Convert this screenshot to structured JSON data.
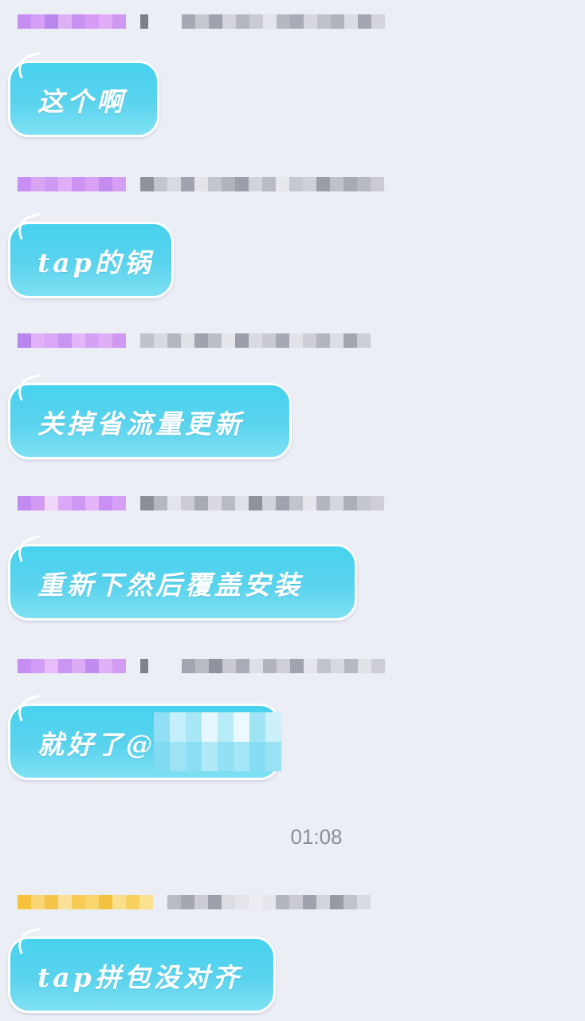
{
  "messages": [
    {
      "text": "这个啊",
      "name_color": "#c98ef0"
    },
    {
      "text": "tap的锅",
      "name_color": "#c98ef0"
    },
    {
      "text": "关掉省流量更新",
      "name_color": "#c98ef0"
    },
    {
      "text": "重新下然后覆盖安装",
      "name_color": "#c98ef0"
    },
    {
      "text": "就好了@",
      "name_color": "#c98ef0"
    },
    {
      "text": "tap拼包没对齐",
      "name_color": "#f5c842"
    }
  ],
  "timestamp": "01:08",
  "colors": {
    "background": "#eceef5",
    "bubble": "#52d1ee",
    "bubble_border": "#ffffff",
    "bubble_text": "#ffffff",
    "timestamp_text": "#8a8e9c"
  }
}
